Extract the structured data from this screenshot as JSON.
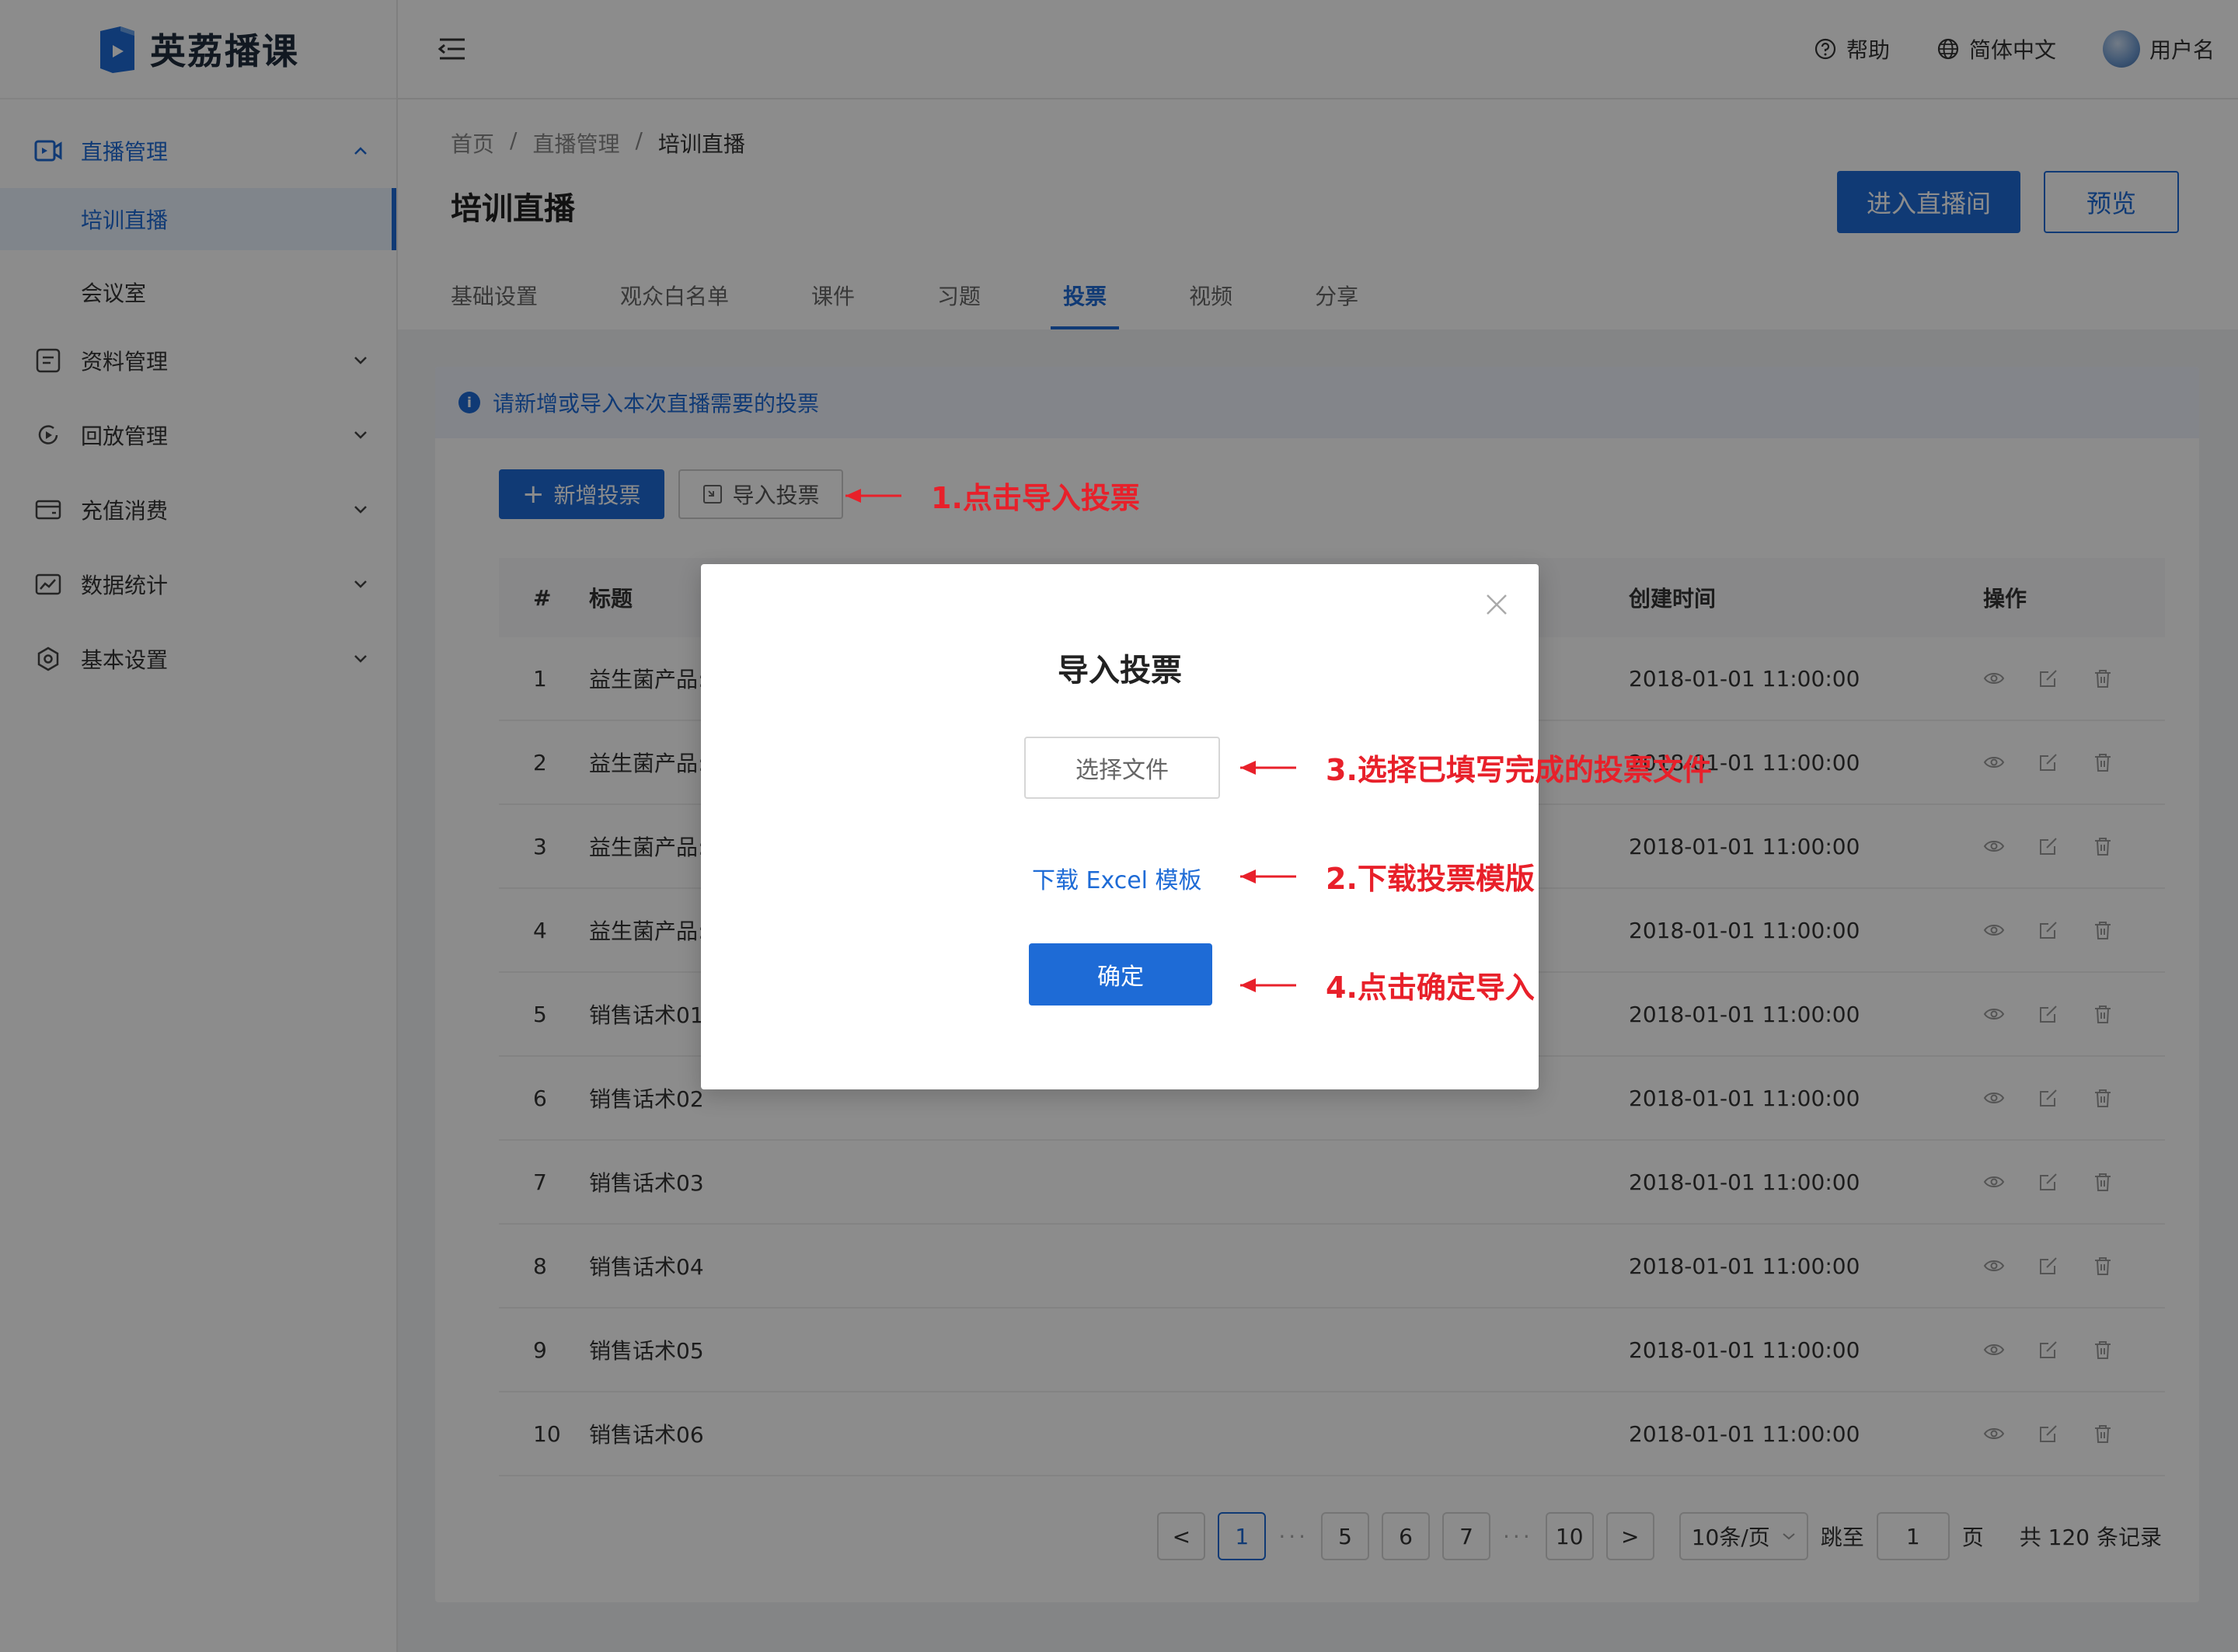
{
  "brand": {
    "name": "英荔播课",
    "color": "#1e6bd6"
  },
  "sidebar": {
    "groups": [
      {
        "label": "直播管理",
        "icon": "live-camera-icon",
        "expanded": true,
        "children": [
          {
            "label": "培训直播",
            "selected": true
          },
          {
            "label": "会议室",
            "selected": false
          }
        ]
      },
      {
        "label": "资料管理",
        "icon": "document-icon",
        "expanded": false
      },
      {
        "label": "回放管理",
        "icon": "replay-icon",
        "expanded": false
      },
      {
        "label": "充值消费",
        "icon": "wallet-icon",
        "expanded": false
      },
      {
        "label": "数据统计",
        "icon": "chart-icon",
        "expanded": false
      },
      {
        "label": "基本设置",
        "icon": "settings-icon",
        "expanded": false
      }
    ]
  },
  "header": {
    "help": "帮助",
    "language": "简体中文",
    "username": "用户名"
  },
  "breadcrumb": [
    "首页",
    "直播管理",
    "培训直播"
  ],
  "page_title": "培训直播",
  "head_buttons": {
    "enter_room": "进入直播间",
    "preview": "预览"
  },
  "tabs": [
    {
      "label": "基础设置",
      "active": false
    },
    {
      "label": "观众白名单",
      "active": false
    },
    {
      "label": "课件",
      "active": false
    },
    {
      "label": "习题",
      "active": false
    },
    {
      "label": "投票",
      "active": true
    },
    {
      "label": "视频",
      "active": false
    },
    {
      "label": "分享",
      "active": false
    }
  ],
  "alert": {
    "icon_text": "i",
    "text": "请新增或导入本次直播需要的投票"
  },
  "toolbar": {
    "add_plus": "+",
    "add_label": "新增投票",
    "import_label": "导入投票"
  },
  "table": {
    "columns": {
      "index": "#",
      "title": "标题",
      "created": "创建时间",
      "ops": "操作"
    },
    "rows": [
      {
        "index": "1",
        "title": "益生菌产品:",
        "created": "2018-01-01 11:00:00"
      },
      {
        "index": "2",
        "title": "益生菌产品:",
        "created": "2018-01-01 11:00:00"
      },
      {
        "index": "3",
        "title": "益生菌产品:",
        "created": "2018-01-01 11:00:00"
      },
      {
        "index": "4",
        "title": "益生菌产品:",
        "created": "2018-01-01 11:00:00"
      },
      {
        "index": "5",
        "title": "销售话术01",
        "created": "2018-01-01 11:00:00"
      },
      {
        "index": "6",
        "title": "销售话术02",
        "created": "2018-01-01 11:00:00"
      },
      {
        "index": "7",
        "title": "销售话术03",
        "created": "2018-01-01 11:00:00"
      },
      {
        "index": "8",
        "title": "销售话术04",
        "created": "2018-01-01 11:00:00"
      },
      {
        "index": "9",
        "title": "销售话术05",
        "created": "2018-01-01 11:00:00"
      },
      {
        "index": "10",
        "title": "销售话术06",
        "created": "2018-01-01 11:00:00"
      }
    ]
  },
  "pagination": {
    "prev": "<",
    "next": ">",
    "dots": "···",
    "pages": [
      "1",
      "5",
      "6",
      "7",
      "10"
    ],
    "current": "1",
    "page_size": "10条/页",
    "jump_label": "跳至",
    "jump_value": "1",
    "page_unit": "页",
    "total": "共 120 条记录"
  },
  "modal": {
    "title": "导入投票",
    "choose_file": "选择文件",
    "download_template": "下载 Excel 模板",
    "confirm": "确定"
  },
  "annotations": {
    "step1": "1.点击导入投票",
    "step2": "2.下载投票模版",
    "step3": "3.选择已填写完成的投票文件",
    "step4": "4.点击确定导入",
    "color": "#e8202a"
  }
}
